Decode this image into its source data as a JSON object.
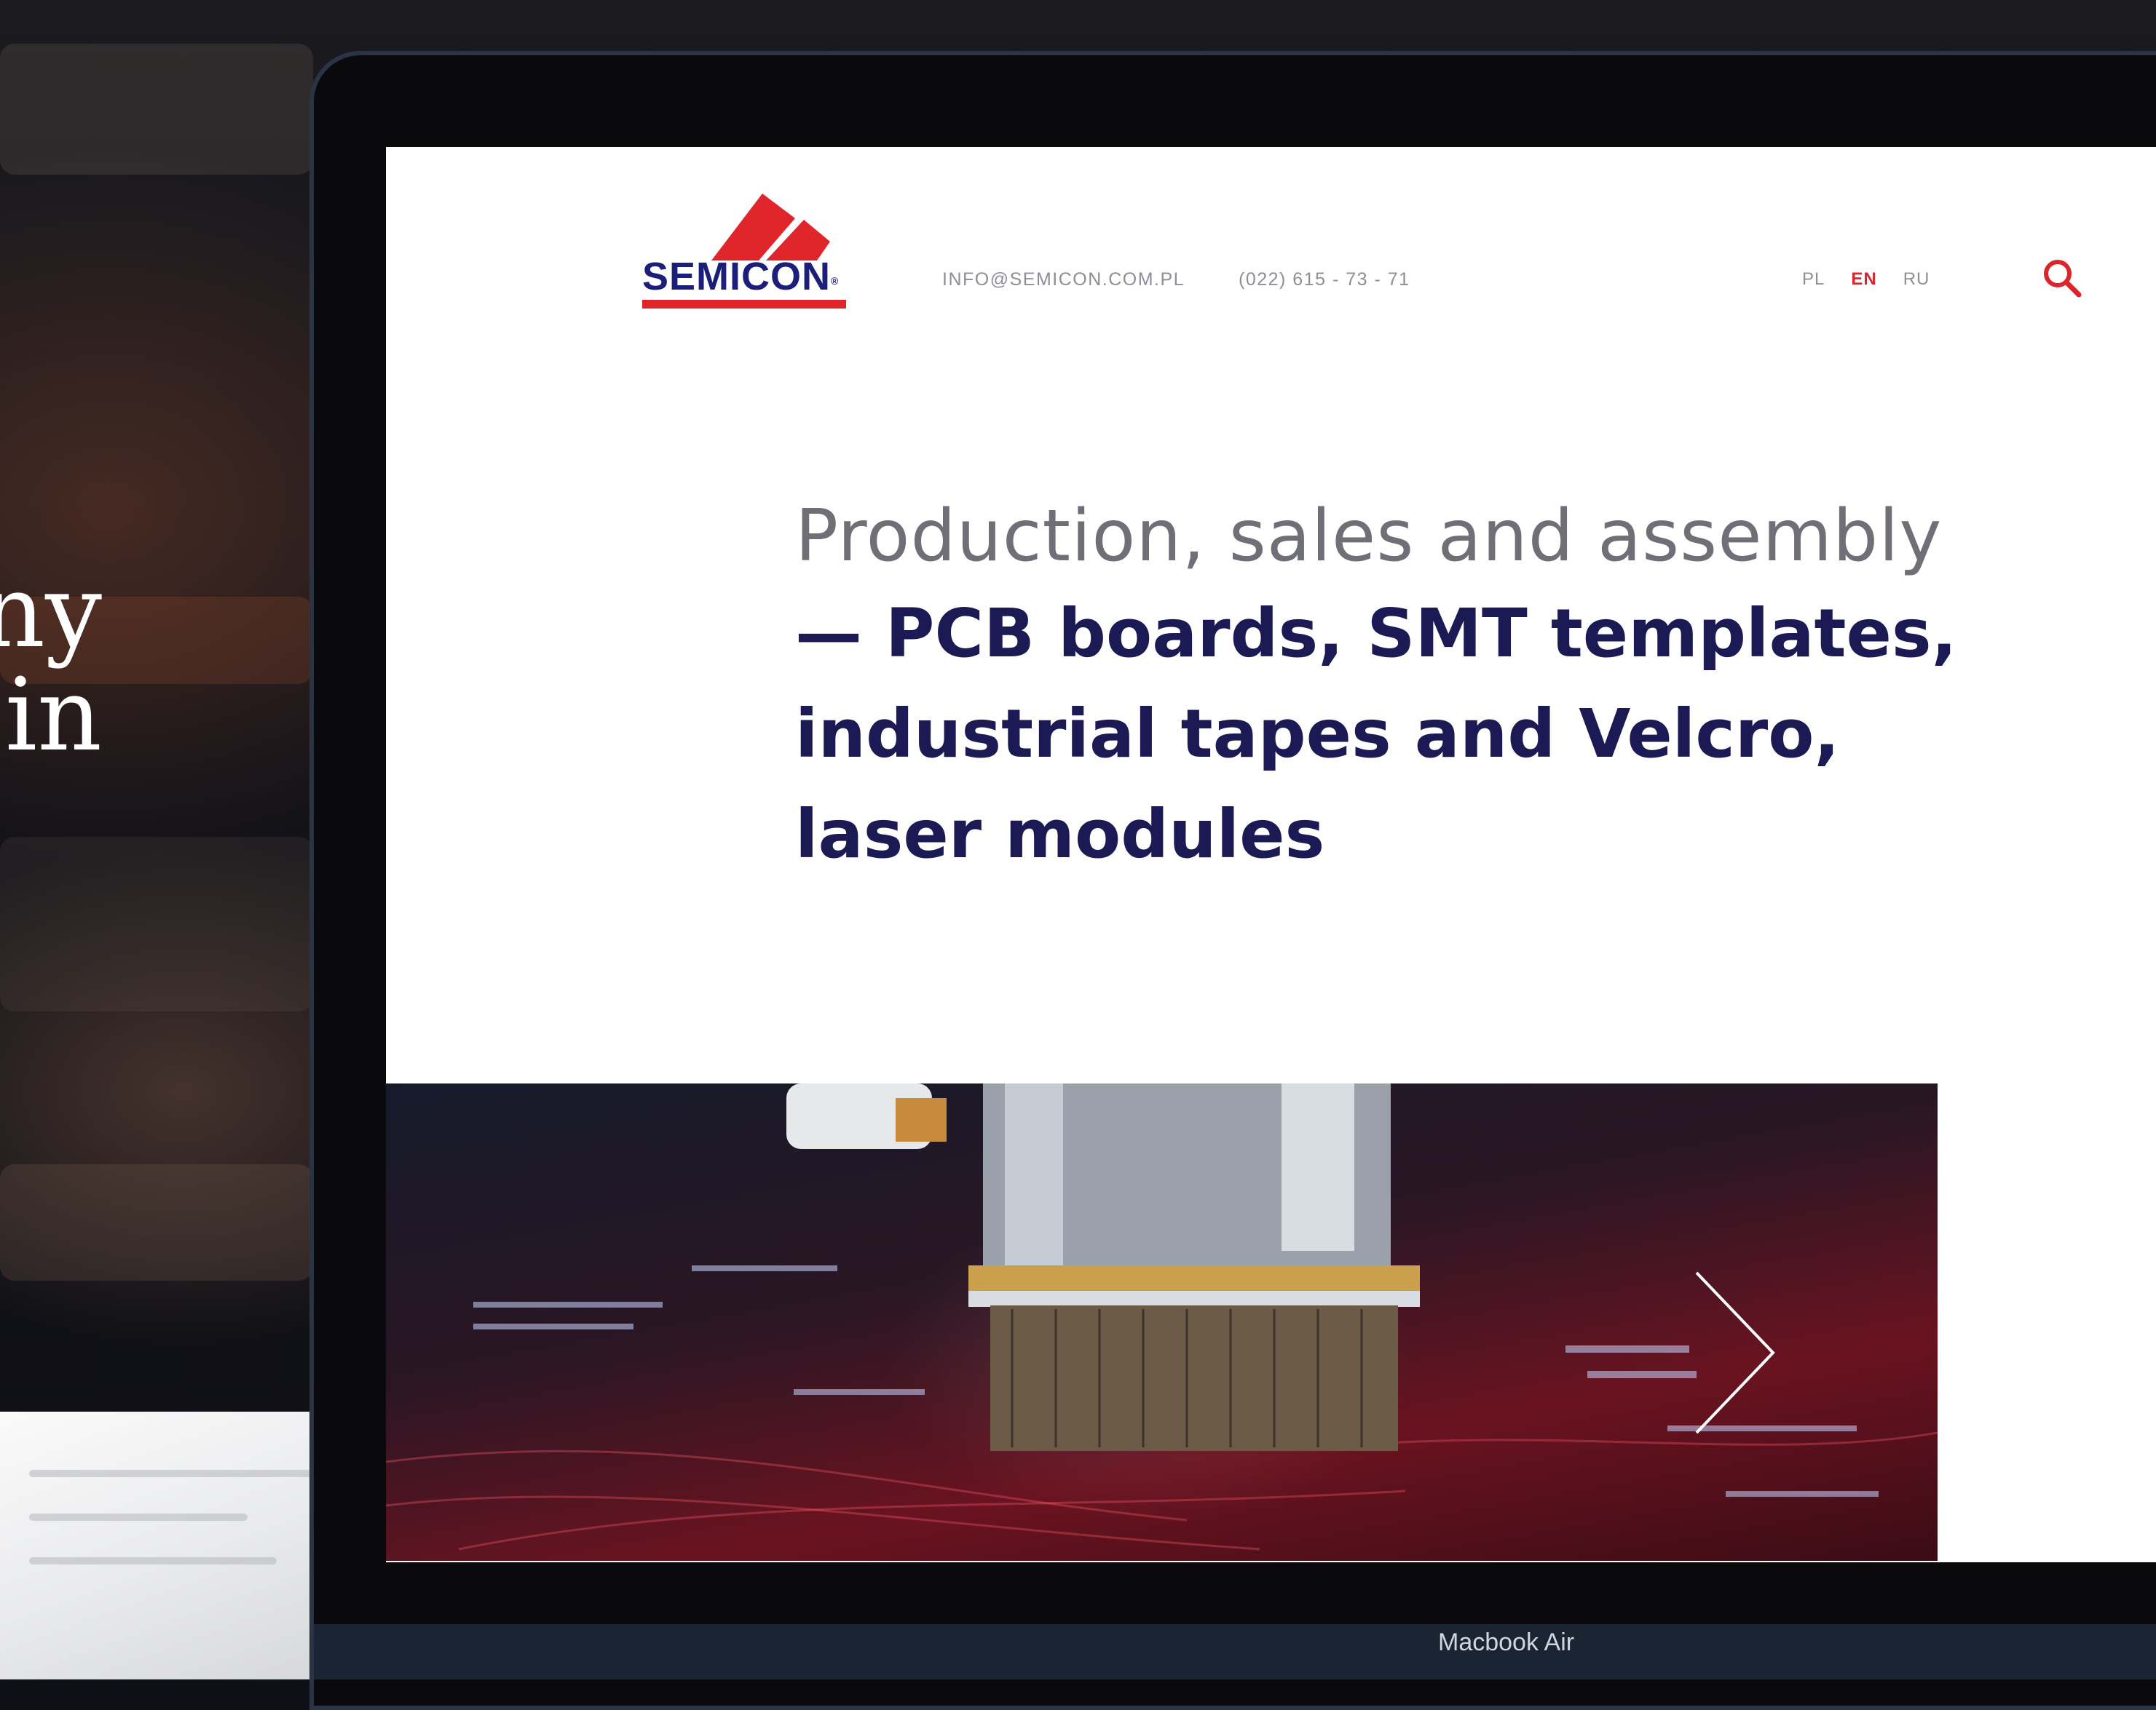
{
  "background": {
    "headline_lines": [
      "ny",
      "in"
    ]
  },
  "device": {
    "model_label": "Macbook Air"
  },
  "site": {
    "logo_text": "SEMICON",
    "logo_mark": "®",
    "email": "INFO@SEMICON.COM.PL",
    "phone": "(022) 615 - 73 - 71",
    "languages": [
      {
        "code": "PL",
        "active": false
      },
      {
        "code": "EN",
        "active": true
      },
      {
        "code": "RU",
        "active": false
      }
    ],
    "search_icon": "search-icon",
    "hero": {
      "light_line": "Production, sales and assembly",
      "bold_text": "— PCB boards, SMT templates, industrial tapes and Velcro, laser modules"
    },
    "slider": {
      "next_icon": "chevron-right-icon"
    }
  },
  "colors": {
    "brand_red": "#e1262b",
    "brand_navy": "#1b1f7a",
    "hero_navy": "#1c1a55",
    "laptop_bezel": "#1b2432"
  }
}
